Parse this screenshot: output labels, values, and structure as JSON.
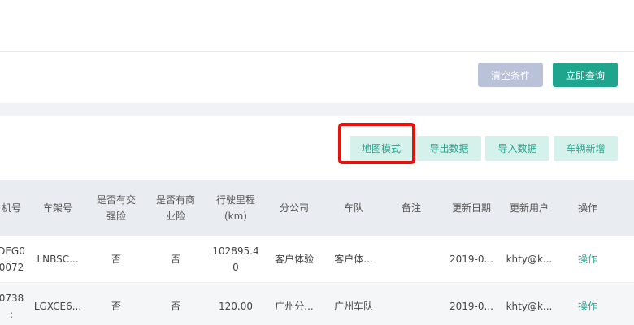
{
  "toolbar": {
    "clear_label": "清空条件",
    "query_label": "立即查询"
  },
  "actions": {
    "map_mode_label": "地图模式",
    "export_label": "导出数据",
    "import_label": "导入数据",
    "add_vehicle_label": "车辆新增"
  },
  "table": {
    "headers": [
      "机号",
      "车架号",
      "是否有交\n强险",
      "是否有商\n业险",
      "行驶里程\n(km)",
      "分公司",
      "车队",
      "备注",
      "更新日期",
      "更新用户",
      "操作"
    ],
    "rows": [
      [
        "DEG0\n0072",
        "LNBSC...",
        "否",
        "否",
        "102895.4\n0",
        "客户体验",
        "客户体...",
        "",
        "2019-0...",
        "khty@k...",
        "操作"
      ],
      [
        "0738\n:",
        "LGXCE6...",
        "否",
        "否",
        "120.00",
        "广州分...",
        "广州车队",
        "",
        "2019-0...",
        "khty@k...",
        "操作"
      ]
    ]
  },
  "colors": {
    "primary": "#1fa58e",
    "secondary_btn": "#b9c2d9",
    "light_btn_bg": "#d5f1ec",
    "light_btn_text": "#28a58f",
    "highlight": "#e8120c",
    "header_bg": "#e9ecf1"
  }
}
